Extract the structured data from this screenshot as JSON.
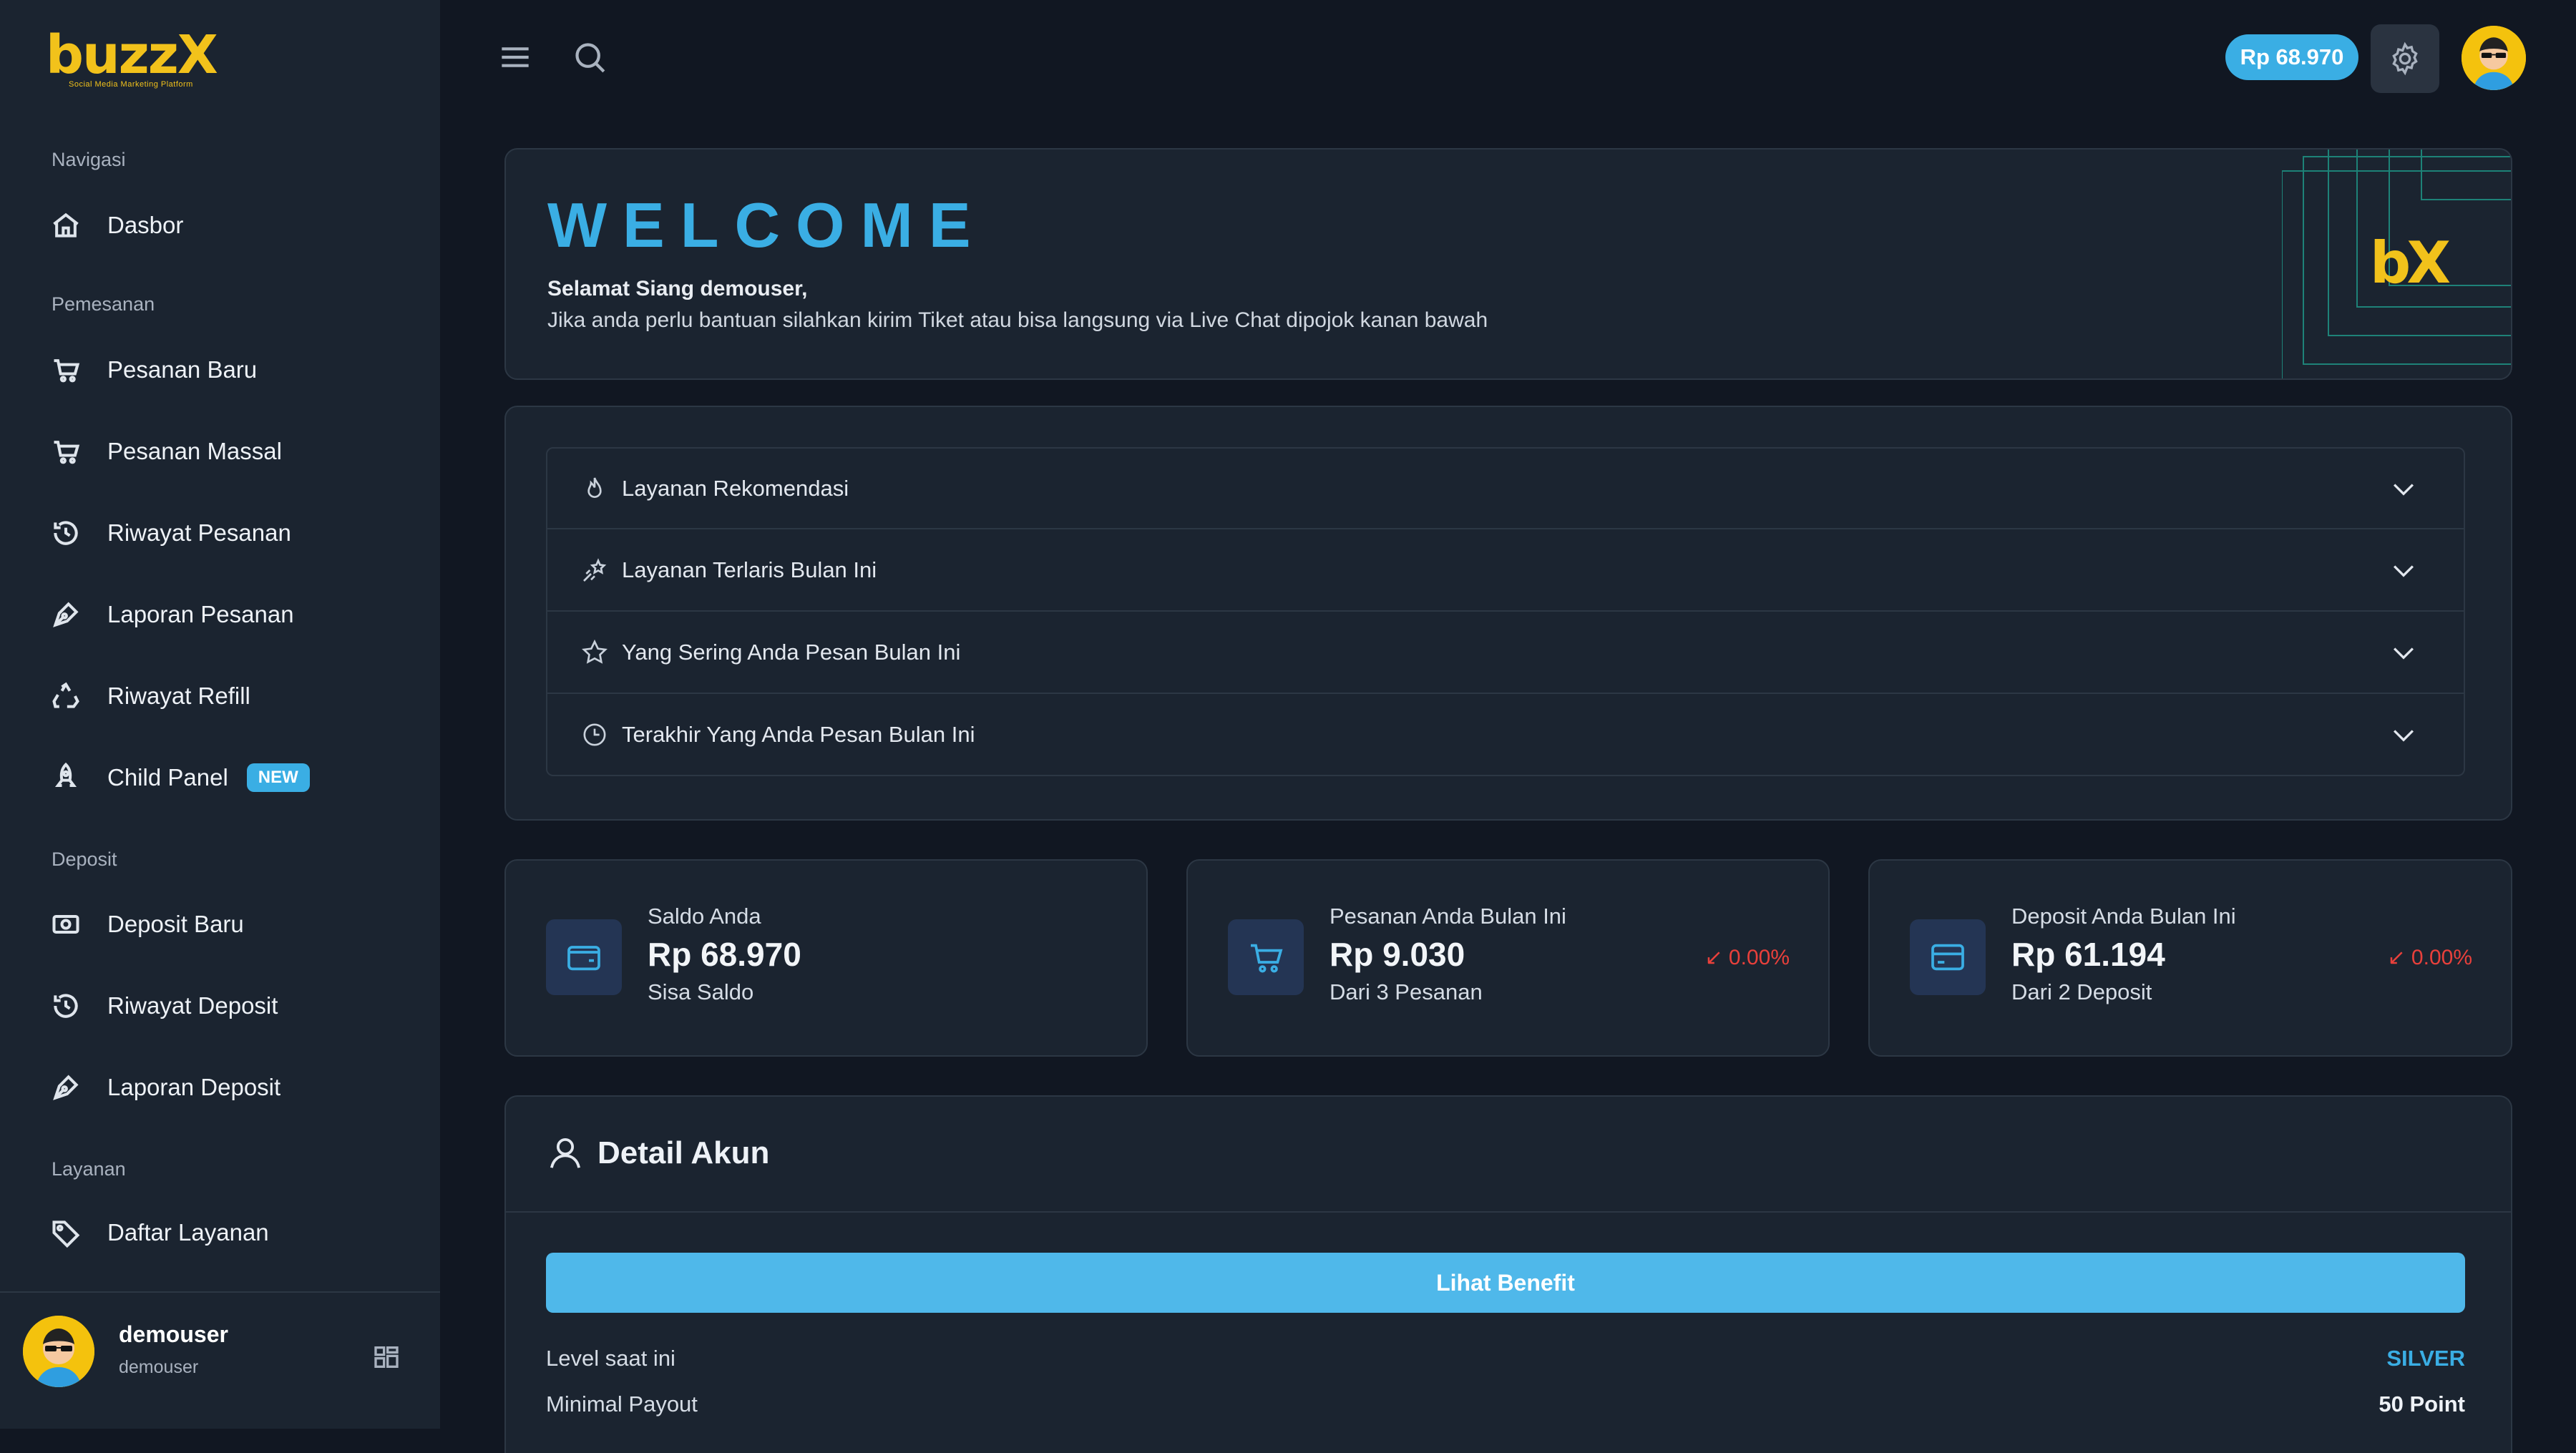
{
  "logo": {
    "word": "buzzX",
    "tagline": "Social Media Marketing Platform"
  },
  "sidebar": {
    "sections": {
      "navigasi": "Navigasi",
      "pemesanan": "Pemesanan",
      "deposit": "Deposit",
      "layanan": "Layanan"
    },
    "items": {
      "dasbor": "Dasbor",
      "pesanan_baru": "Pesanan Baru",
      "pesanan_massal": "Pesanan Massal",
      "riwayat_pesanan": "Riwayat Pesanan",
      "laporan_pesanan": "Laporan Pesanan",
      "riwayat_refill": "Riwayat Refill",
      "child_panel": "Child Panel",
      "child_panel_badge": "NEW",
      "deposit_baru": "Deposit Baru",
      "riwayat_deposit": "Riwayat Deposit",
      "laporan_deposit": "Laporan Deposit",
      "daftar_layanan": "Daftar Layanan"
    },
    "user": {
      "name": "demouser",
      "username": "demouser"
    }
  },
  "topbar": {
    "balance": "Rp 68.970"
  },
  "welcome": {
    "title": "WELCOME",
    "greeting": "Selamat Siang demouser,",
    "message": "Jika anda perlu bantuan silahkan kirim Tiket atau bisa langsung via Live Chat dipojok kanan bawah",
    "logo_text": "bX"
  },
  "accordion": [
    {
      "label": "Layanan Rekomendasi",
      "icon": "fire-icon"
    },
    {
      "label": "Layanan Terlaris Bulan Ini",
      "icon": "shooting-star-icon"
    },
    {
      "label": "Yang Sering Anda Pesan Bulan Ini",
      "icon": "star-icon"
    },
    {
      "label": "Terakhir Yang Anda Pesan Bulan Ini",
      "icon": "clock-icon"
    }
  ],
  "stats": [
    {
      "label": "Saldo Anda",
      "value": "Rp 68.970",
      "sub": "Sisa Saldo",
      "delta": "",
      "icon": "wallet-icon"
    },
    {
      "label": "Pesanan Anda Bulan Ini",
      "value": "Rp 9.030",
      "sub": "Dari 3 Pesanan",
      "delta": "↙ 0.00%",
      "icon": "cart-icon"
    },
    {
      "label": "Deposit Anda Bulan Ini",
      "value": "Rp 61.194",
      "sub": "Dari 2 Deposit",
      "delta": "↙ 0.00%",
      "icon": "credit-card-icon"
    }
  ],
  "detail": {
    "title": "Detail Akun",
    "benefit_button": "Lihat Benefit",
    "level_label": "Level saat ini",
    "level_value": "SILVER",
    "payout_label": "Minimal Payout",
    "payout_value": "50 Point"
  },
  "colors": {
    "accent": "#3aaee4",
    "brand_yellow": "#f2c21b",
    "negative": "#e8403b",
    "background": "#111722",
    "card": "#1b2430"
  }
}
